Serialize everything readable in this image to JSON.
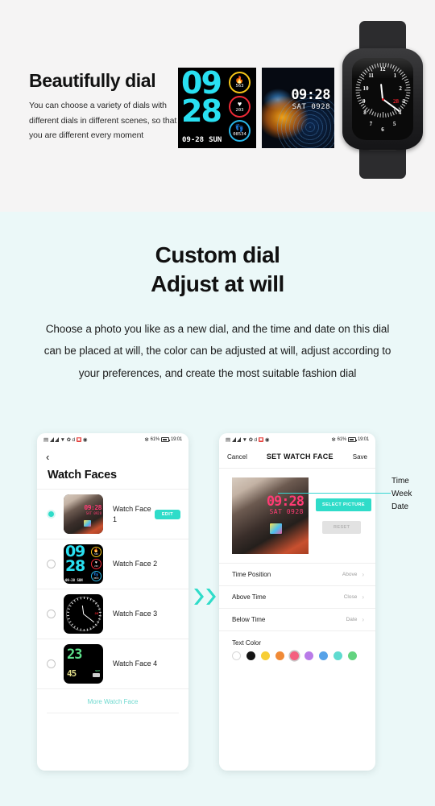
{
  "top_section": {
    "heading": "Beautifully dial",
    "description": "You can choose a variety of dials with different dials in different scenes, so that you are different every moment",
    "bg_color": "#F5F4F4",
    "tile_a": {
      "name": "watchface-digital-rings",
      "hours": "09",
      "minutes": "28",
      "date": "09-28",
      "weekday": "SUN",
      "rings": [
        {
          "icon": "flame-icon",
          "glyph": "🔥",
          "value": "563",
          "color": "#F5C518"
        },
        {
          "icon": "heart-icon",
          "glyph": "♥",
          "value": "203",
          "color": "#EF2A36"
        },
        {
          "icon": "steps-icon",
          "glyph": "👣",
          "value": "08534",
          "color": "#29B6E8"
        }
      ]
    },
    "tile_b": {
      "name": "watchface-fish-wallpaper",
      "time": "09:28",
      "date": "SAT 0928"
    },
    "watch_photo": {
      "name": "smartwatch-product-photo",
      "numerals": [
        "12",
        "1",
        "2",
        "3",
        "4",
        "5",
        "6",
        "7",
        "8",
        "9",
        "10",
        "11"
      ],
      "highlight_numeral": "28",
      "highlight_color": "#E8202A"
    }
  },
  "mid_section": {
    "bg_color": "#EBF8F8",
    "heading_line1": "Custom dial",
    "heading_line2": "Adjust at will",
    "paragraph": "Choose a photo you like as a new dial, and the time and date on this dial can be placed at will, the color can be adjusted at will, adjust according to your preferences, and create the most suitable fashion dial"
  },
  "phone_left": {
    "status_bar": {
      "battery_percent": "61%",
      "time": "19:01",
      "icons": [
        "sim-icon",
        "signal-icon",
        "signal-icon",
        "wifi-icon",
        "bluetooth-icon",
        "data-icon",
        "alarm-icon",
        "dnd-icon"
      ]
    },
    "back_label": "‹",
    "title": "Watch Faces",
    "rows": [
      {
        "label": "Watch Face 1",
        "selected": true,
        "has_edit": true,
        "edit_label": "EDIT",
        "thumb": "photo"
      },
      {
        "label": "Watch Face 2",
        "selected": false,
        "has_edit": false,
        "edit_label": "",
        "thumb": "digital"
      },
      {
        "label": "Watch Face 3",
        "selected": false,
        "has_edit": false,
        "edit_label": "",
        "thumb": "analog"
      },
      {
        "label": "Watch Face 4",
        "selected": false,
        "has_edit": false,
        "edit_label": "",
        "thumb": "lcd"
      }
    ],
    "thumb_photo": {
      "time": "09:28",
      "date": "SAT 0928"
    },
    "thumb_digital": {
      "hours": "09",
      "minutes": "28",
      "date": "09-28",
      "weekday": "SUN",
      "rings": [
        {
          "glyph": "🔥",
          "value": "563"
        },
        {
          "glyph": "♥",
          "value": "203"
        },
        {
          "glyph": "👣",
          "value": "0853"
        }
      ]
    },
    "thumb_analog": {
      "highlight_numeral": "28"
    },
    "thumb_lcd": {
      "big": "23",
      "small": "45",
      "tag": "SAT"
    },
    "more_link": "More Watch Face"
  },
  "phone_right": {
    "status_bar": {
      "battery_percent": "61%",
      "time": "19:01"
    },
    "nav": {
      "cancel": "Cancel",
      "title": "SET WATCH FACE",
      "save": "Save"
    },
    "preview": {
      "time": "09:28",
      "date": "SAT 0928",
      "text_color": "#FF3B74"
    },
    "buttons": {
      "select_picture": "SELECT PICTURE",
      "reset": "RESET"
    },
    "options": [
      {
        "label": "Time Position",
        "value": "Above"
      },
      {
        "label": "Above Time",
        "value": "Close"
      },
      {
        "label": "Below Time",
        "value": "Date"
      }
    ],
    "text_color_label": "Text Color",
    "swatches": [
      {
        "name": "white",
        "hex": "#FFFFFF",
        "selected": false
      },
      {
        "name": "black",
        "hex": "#141414",
        "selected": false
      },
      {
        "name": "yellow",
        "hex": "#F7CE36",
        "selected": false
      },
      {
        "name": "orange",
        "hex": "#F08A36",
        "selected": false
      },
      {
        "name": "pink",
        "hex": "#F4607F",
        "selected": true
      },
      {
        "name": "purple",
        "hex": "#B97BE8",
        "selected": false
      },
      {
        "name": "blue",
        "hex": "#56A2E8",
        "selected": false
      },
      {
        "name": "cyan",
        "hex": "#5FDBD0",
        "selected": false
      },
      {
        "name": "green",
        "hex": "#62D37F",
        "selected": false
      }
    ]
  },
  "annotation": {
    "line1": "Time",
    "line2": "Week",
    "line3": "Date",
    "accent_color": "#37D6D2"
  },
  "arrow": {
    "name": "double-chevron-right",
    "color": "#2FDCC9"
  }
}
